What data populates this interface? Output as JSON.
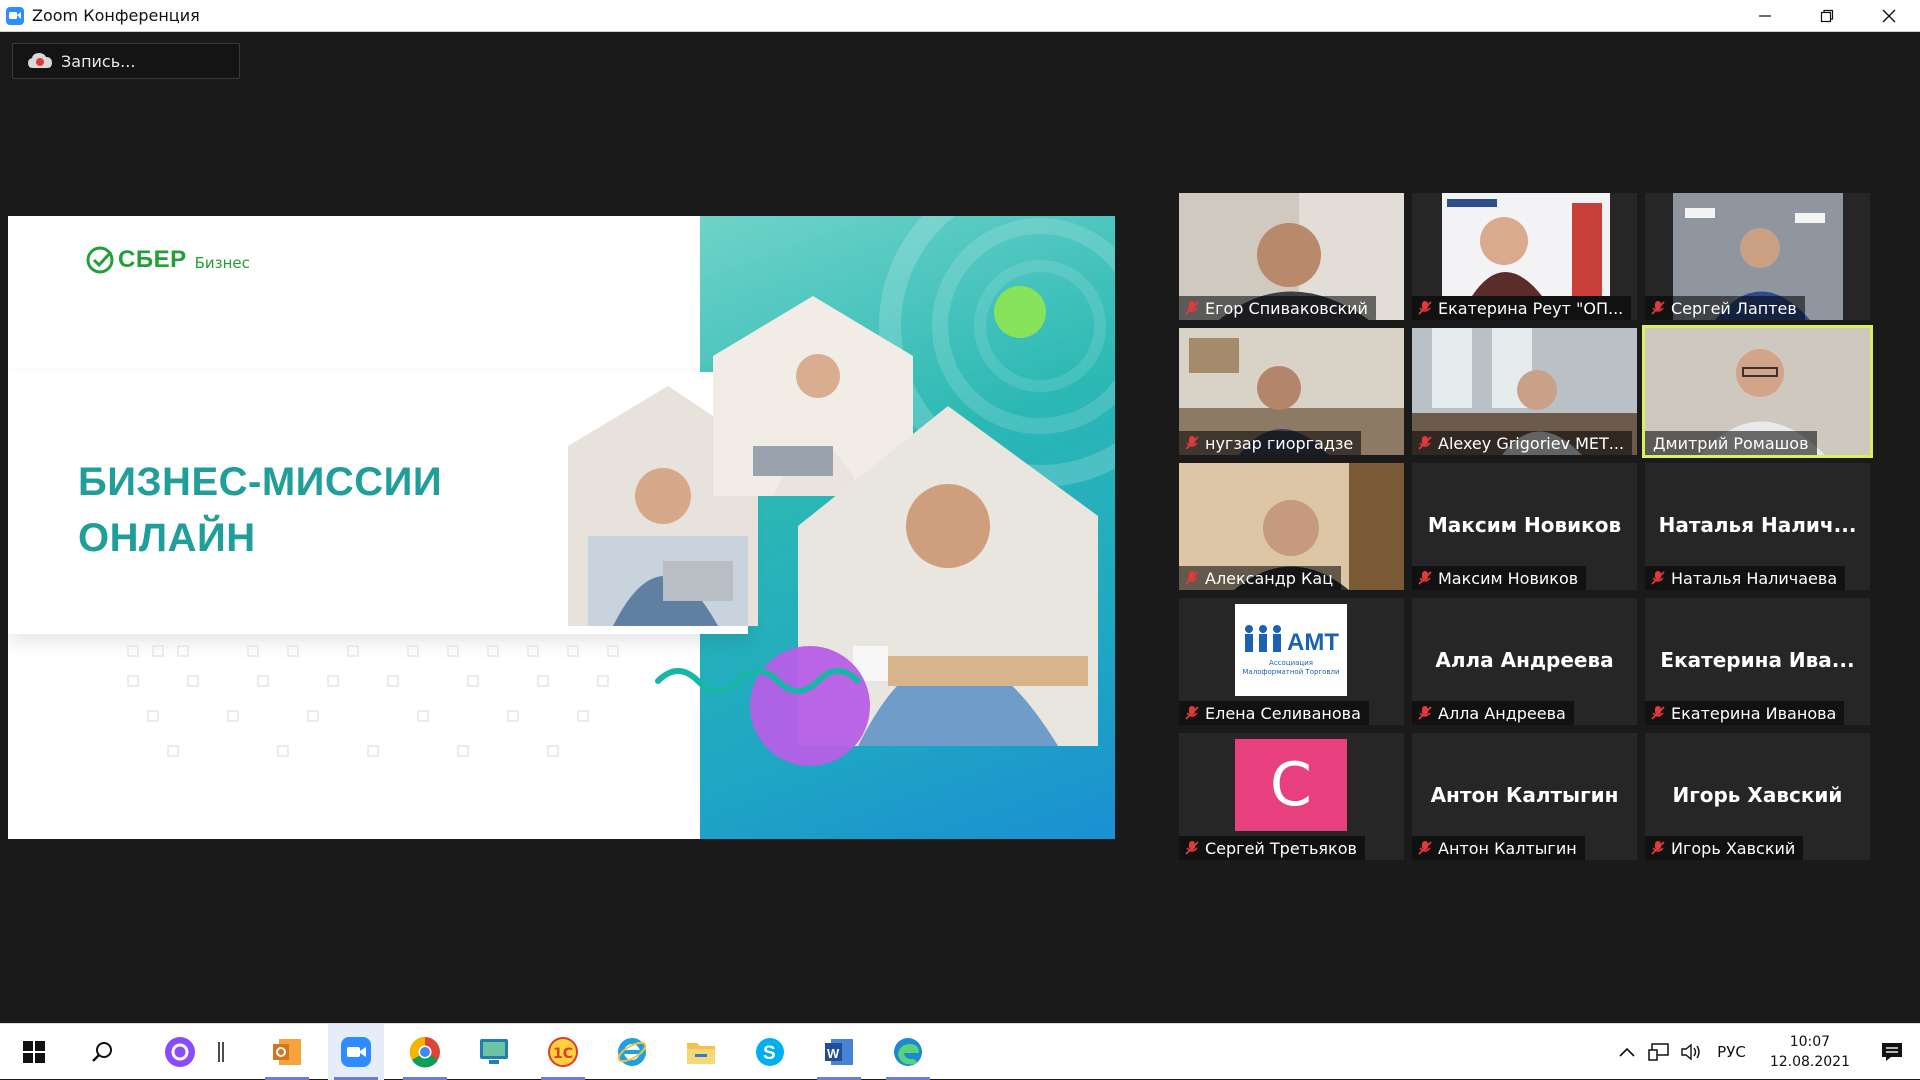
{
  "window": {
    "title": "Zoom Конференция"
  },
  "recording": {
    "label": "Запись..."
  },
  "slide": {
    "brand_word": "СБЕР",
    "brand_sub": "Бизнес",
    "headline_line1": "БИЗНЕС-МИССИИ",
    "headline_line2": "ОНЛАЙН"
  },
  "participants": [
    {
      "name": "Егор Спиваковский",
      "video": true,
      "center_name": ""
    },
    {
      "name": "Екатерина Реут \"ОП...",
      "video": true,
      "center_name": ""
    },
    {
      "name": "Сергей Лаптев",
      "video": true,
      "center_name": ""
    },
    {
      "name": "нугзар гиоргадзе",
      "video": true,
      "center_name": ""
    },
    {
      "name": "Alexey Grigoriev МЕТ...",
      "video": true,
      "center_name": ""
    },
    {
      "name": "Дмитрий Ромашов",
      "video": true,
      "center_name": "",
      "active_speaker": true
    },
    {
      "name": "Александр Кац",
      "video": true,
      "center_name": ""
    },
    {
      "name": "Максим Новиков",
      "video": false,
      "center_name": "Максим Новиков"
    },
    {
      "name": "Наталья Наличаева",
      "video": false,
      "center_name": "Наталья  Налич..."
    },
    {
      "name": "Елена Селиванова",
      "video": false,
      "center_name": "",
      "logo": "АМТ",
      "logo_sub": "Ассоциация Малоформатной Торговли"
    },
    {
      "name": "Алла Андреева",
      "video": false,
      "center_name": "Алла Андреева"
    },
    {
      "name": "Екатерина Иванова",
      "video": false,
      "center_name": "Екатерина  Ива..."
    },
    {
      "name": "Сергей Третьяков",
      "video": false,
      "center_name": "",
      "avatar_letter": "С"
    },
    {
      "name": "Антон Калтыгин",
      "video": false,
      "center_name": "Антон Калтыгин"
    },
    {
      "name": "Игорь Хавский",
      "video": false,
      "center_name": "Игорь Хавский"
    }
  ],
  "taskbar": {
    "lang": "РУС",
    "time": "10:07",
    "date": "12.08.2021"
  },
  "colors": {
    "accent_active_speaker": "#d7f25c",
    "sber_green": "#21a038",
    "headline_teal": "#1f9e9a",
    "mic_muted_red": "#e0393e"
  }
}
